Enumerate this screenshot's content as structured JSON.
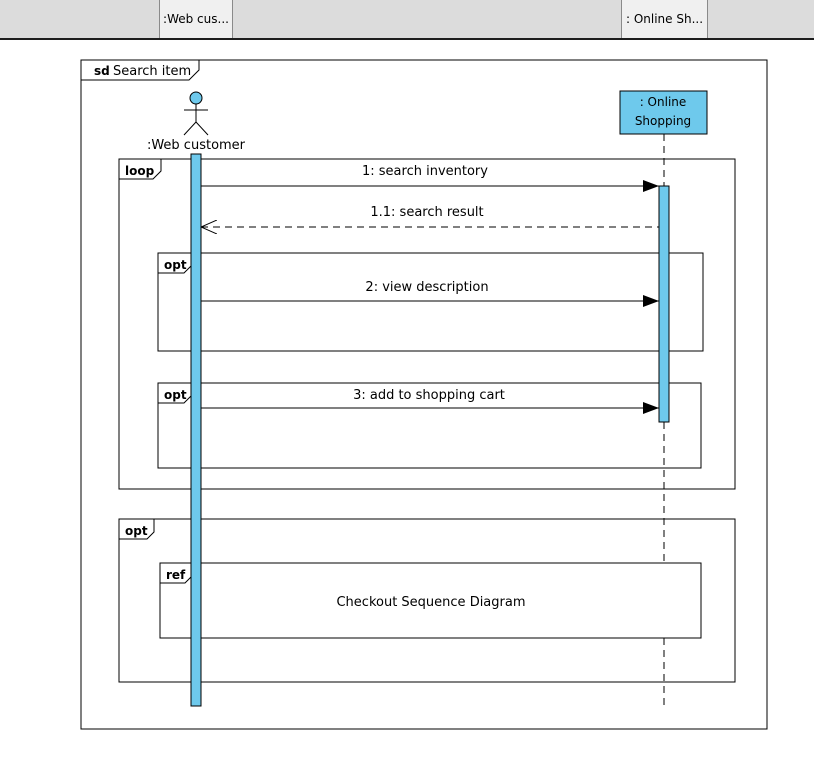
{
  "header_bar": {
    "lifeline_1": ":Web cus...",
    "lifeline_2": ": Online Sh..."
  },
  "diagram": {
    "frame_keyword": "sd",
    "frame_title": "Search item",
    "actor_label": ":Web customer",
    "object_label_line1": ": Online",
    "object_label_line2": "Shopping",
    "colors": {
      "lifeline_fill": "#6ec9ec",
      "line": "#000000"
    },
    "fragments": {
      "loop": {
        "operator": "loop"
      },
      "opt1": {
        "operator": "opt"
      },
      "opt2": {
        "operator": "opt"
      },
      "opt3": {
        "operator": "opt"
      },
      "ref": {
        "operator": "ref",
        "label": "Checkout Sequence Diagram"
      }
    },
    "messages": {
      "m1": "1: search inventory",
      "m2": "1.1: search result",
      "m3": "2: view description",
      "m4": "3: add to shopping cart"
    }
  }
}
